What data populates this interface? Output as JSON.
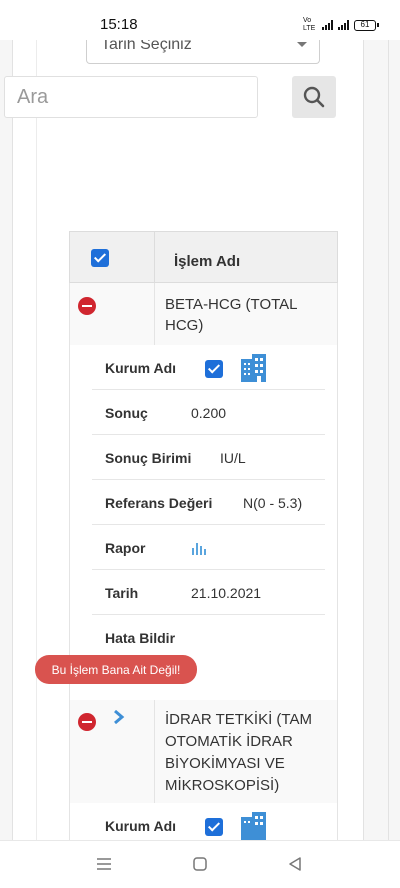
{
  "status_bar": {
    "time": "15:18",
    "network": "Vo LTE",
    "battery": "61"
  },
  "filter": {
    "date_select_label": "Tarih Seçiniz"
  },
  "search": {
    "placeholder": "Ara"
  },
  "table": {
    "header": "İşlem Adı"
  },
  "records": [
    {
      "name_line1": "BETA-HCG (TOTAL",
      "name_line2": "HCG)",
      "fields": {
        "institution_label": "Kurum Adı",
        "result_label": "Sonuç",
        "result_value": "0.200",
        "unit_label": "Sonuç Birimi",
        "unit_value": "IU/L",
        "reference_label": "Referans Değeri",
        "reference_value": "N(0 - 5.3)",
        "report_label": "Rapor",
        "date_label": "Tarih",
        "date_value": "21.10.2021",
        "report_error_label": "Hata Bildir",
        "report_error_button": "Bu İşlem Bana Ait Değil!"
      }
    },
    {
      "name_line1": "İDRAR TETKİKİ (TAM",
      "name_line2": "OTOMATİK İDRAR",
      "name_line3": "BİYOKİMYASI VE",
      "name_line4": "MİKROSKOPİSİ)",
      "fields": {
        "institution_label": "Kurum Adı"
      }
    }
  ],
  "colors": {
    "checkbox": "#1e6fd9",
    "remove": "#d0262f",
    "error_button": "#d9534f",
    "building_icon": "#3e8fd6",
    "chevron": "#3e8fd6"
  },
  "icons": [
    "search-icon",
    "remove-icon",
    "chevron-right-icon",
    "building-icon",
    "chart-icon",
    "menu-icon",
    "home-icon",
    "back-icon"
  ]
}
